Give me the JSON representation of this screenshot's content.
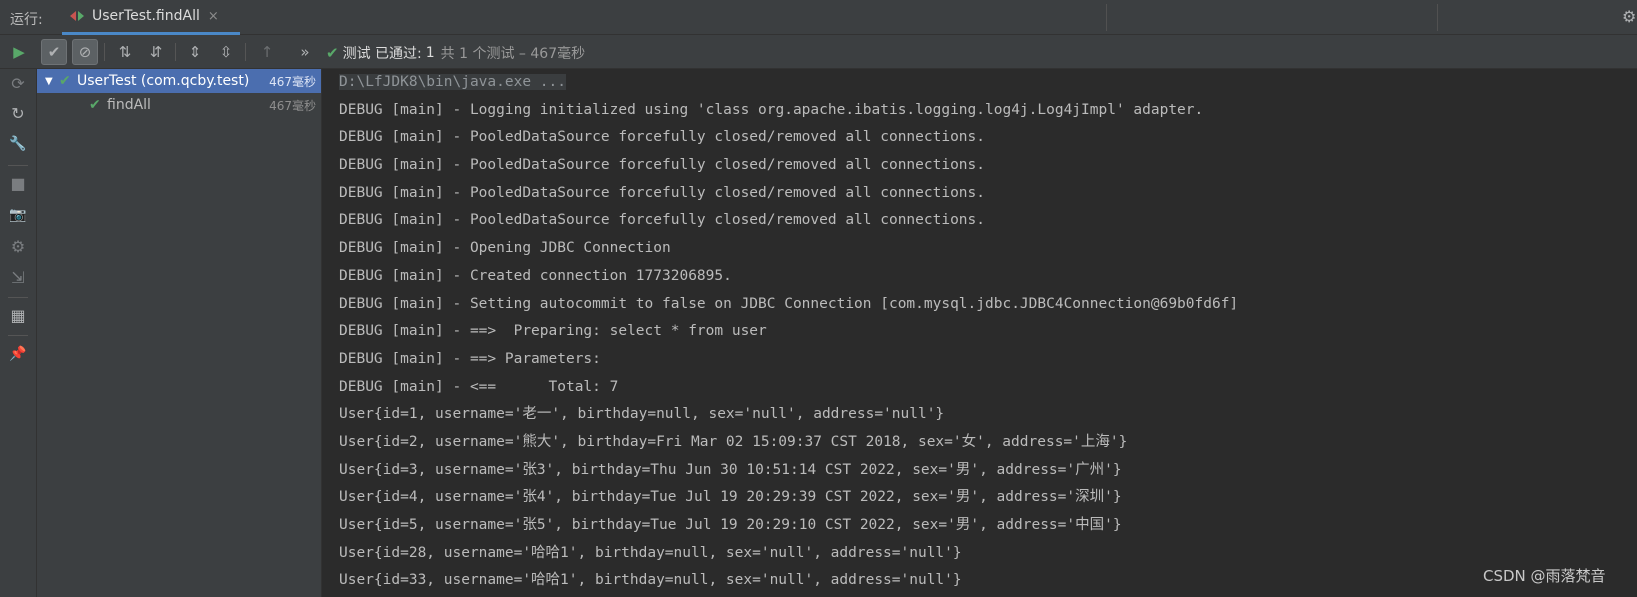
{
  "topbar": {
    "run_label": "运行:",
    "tab": {
      "title": "UserTest.findAll",
      "icon": "run-config-icon",
      "close": "×"
    },
    "settings_icon": "gear-icon"
  },
  "toolbar": {
    "buttons": [
      {
        "name": "rerun-button",
        "icon": "play-icon",
        "glyph": "▶"
      },
      {
        "name": "show-passed-toggle",
        "icon": "check-icon",
        "glyph": "✔",
        "toggled": true
      },
      {
        "name": "show-ignored-toggle",
        "icon": "prohibit-icon",
        "glyph": "⊘",
        "toggled": true
      },
      {
        "name": "sort-alpha-button",
        "icon": "sort-alpha-icon",
        "glyph": "⇅"
      },
      {
        "name": "sort-duration-button",
        "icon": "sort-duration-icon",
        "glyph": "⇵"
      },
      {
        "name": "expand-all-button",
        "icon": "expand-all-icon",
        "glyph": "⇕"
      },
      {
        "name": "collapse-all-button",
        "icon": "collapse-all-icon",
        "glyph": "⇳"
      },
      {
        "name": "prev-failed-button",
        "icon": "arrow-up-icon",
        "glyph": "↑"
      },
      {
        "name": "more-button",
        "icon": "double-chevron-icon",
        "glyph": "»"
      }
    ],
    "status": {
      "icon": "check-icon",
      "label": "测试 已通过:",
      "count": "1",
      "detail": "共 1 个测试 – 467毫秒"
    }
  },
  "sidebar": {
    "icons": [
      {
        "name": "rerun-failed-icon",
        "glyph": "⟳",
        "enabled": false
      },
      {
        "name": "toggle-autotest-icon",
        "glyph": "↻",
        "enabled": true
      },
      {
        "name": "wrench-icon",
        "glyph": "🔧",
        "enabled": true
      },
      {
        "name": "stop-icon",
        "glyph": "■",
        "enabled": false
      },
      {
        "name": "camera-icon",
        "glyph": "📷",
        "enabled": false
      },
      {
        "name": "settings-gear-icon",
        "glyph": "⚙",
        "enabled": false
      },
      {
        "name": "import-icon",
        "glyph": "⇲",
        "enabled": false
      },
      {
        "name": "layout-icon",
        "glyph": "▦",
        "enabled": true
      },
      {
        "name": "pin-icon",
        "glyph": "📌",
        "enabled": true
      }
    ]
  },
  "tree": {
    "root": {
      "name": "UserTest (com.qcby.test)",
      "time": "467毫秒"
    },
    "child": {
      "name": "findAll",
      "time": "467毫秒"
    }
  },
  "console": {
    "lines": [
      "D:\\LfJDK8\\bin\\java.exe ...",
      "DEBUG [main] - Logging initialized using 'class org.apache.ibatis.logging.log4j.Log4jImpl' adapter.",
      "DEBUG [main] - PooledDataSource forcefully closed/removed all connections.",
      "DEBUG [main] - PooledDataSource forcefully closed/removed all connections.",
      "DEBUG [main] - PooledDataSource forcefully closed/removed all connections.",
      "DEBUG [main] - PooledDataSource forcefully closed/removed all connections.",
      "DEBUG [main] - Opening JDBC Connection",
      "DEBUG [main] - Created connection 1773206895.",
      "DEBUG [main] - Setting autocommit to false on JDBC Connection [com.mysql.jdbc.JDBC4Connection@69b0fd6f]",
      "DEBUG [main] - ==>  Preparing: select * from user",
      "DEBUG [main] - ==> Parameters: ",
      "DEBUG [main] - <==      Total: 7",
      "User{id=1, username='老一', birthday=null, sex='null', address='null'}",
      "User{id=2, username='熊大', birthday=Fri Mar 02 15:09:37 CST 2018, sex='女', address='上海'}",
      "User{id=3, username='张3', birthday=Thu Jun 30 10:51:14 CST 2022, sex='男', address='广州'}",
      "User{id=4, username='张4', birthday=Tue Jul 19 20:29:39 CST 2022, sex='男', address='深圳'}",
      "User{id=5, username='张5', birthday=Tue Jul 19 20:29:10 CST 2022, sex='男', address='中国'}",
      "User{id=28, username='哈哈1', birthday=null, sex='null', address='null'}",
      "User{id=33, username='哈哈1', birthday=null, sex='null', address='null'}"
    ]
  },
  "watermark": "CSDN @雨落梵音",
  "colors": {
    "accent": "#4a88c7",
    "pass": "#59a869",
    "selection": "#4b6eaf"
  }
}
